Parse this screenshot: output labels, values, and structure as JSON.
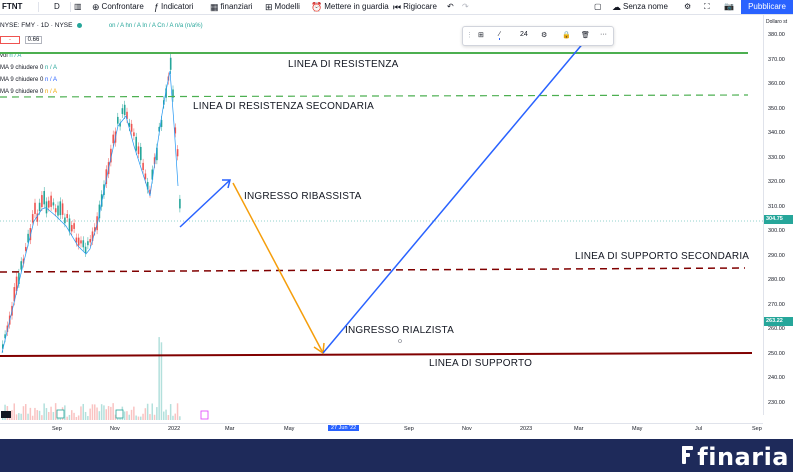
{
  "toolbar": {
    "ticker": "FTNT",
    "interval": "D",
    "compare_label": "Confrontare",
    "indicators_label": "Indicatori",
    "financials_label": "finanziari",
    "models_label": "Modelli",
    "alert_label": "Mettere in guardia",
    "replay_label": "Rigiocare",
    "layout_name": "Senza nome",
    "publish_label": "Pubblicare"
  },
  "legend": {
    "symbol_line": "NYSE: FMY · 1D · NYSE",
    "ohlc_values": "on / A hn / A In / A Cn / A n/a (n/a%)",
    "price_box_1": "-",
    "price_box_2": "0.66",
    "vol_label": "vol",
    "vol_value": "n / A",
    "ma1_label": "MA 9 chiudere 0",
    "ma1_value": "n / A",
    "ma2_label": "MA 9 chiudere 0",
    "ma2_value": "n / A",
    "ma3_label": "MA 9 chiudere 0",
    "ma3_value": "n / A"
  },
  "drawing_toolbar": {
    "line_width": "24"
  },
  "annotations": {
    "resistance": "LINEA DI RESISTENZA",
    "secondary_resistance": "LINEA DI RESISTENZA SECONDARIA",
    "bearish_entry": "INGRESSO RIBASSISTA",
    "secondary_support": "LINEA DI SUPPORTO SECONDARIA",
    "bullish_entry": "INGRESSO RIALZISTA",
    "support": "LINEA DI SUPPORTO"
  },
  "price_axis": {
    "currency_label": "Dollaro st",
    "ticks": [
      "380.00",
      "370.00",
      "360.00",
      "350.00",
      "340.00",
      "330.00",
      "320.00",
      "310.00",
      "300.00",
      "290.00",
      "280.00",
      "270.00",
      "260.00",
      "250.00",
      "240.00",
      "230.00"
    ],
    "current_price": "304.75",
    "second_price": "263.22",
    "current_color": "#26a69a",
    "second_color": "#26a69a"
  },
  "time_axis": {
    "labels": [
      "Sep",
      "Nov",
      "2022",
      "Mar",
      "May",
      "27 Jun '22",
      "Sep",
      "Nov",
      "2023",
      "Mar",
      "May",
      "Jul",
      "Sep"
    ],
    "highlight": "27 Jun '22"
  },
  "colors": {
    "resistance": "#4caf50",
    "support": "#800000",
    "bull_arrow": "#2962ff",
    "bear_arrow": "#f59e0b",
    "candle_up": "#26a69a",
    "candle_down": "#ef5350"
  },
  "brand": {
    "name": "finaria"
  }
}
